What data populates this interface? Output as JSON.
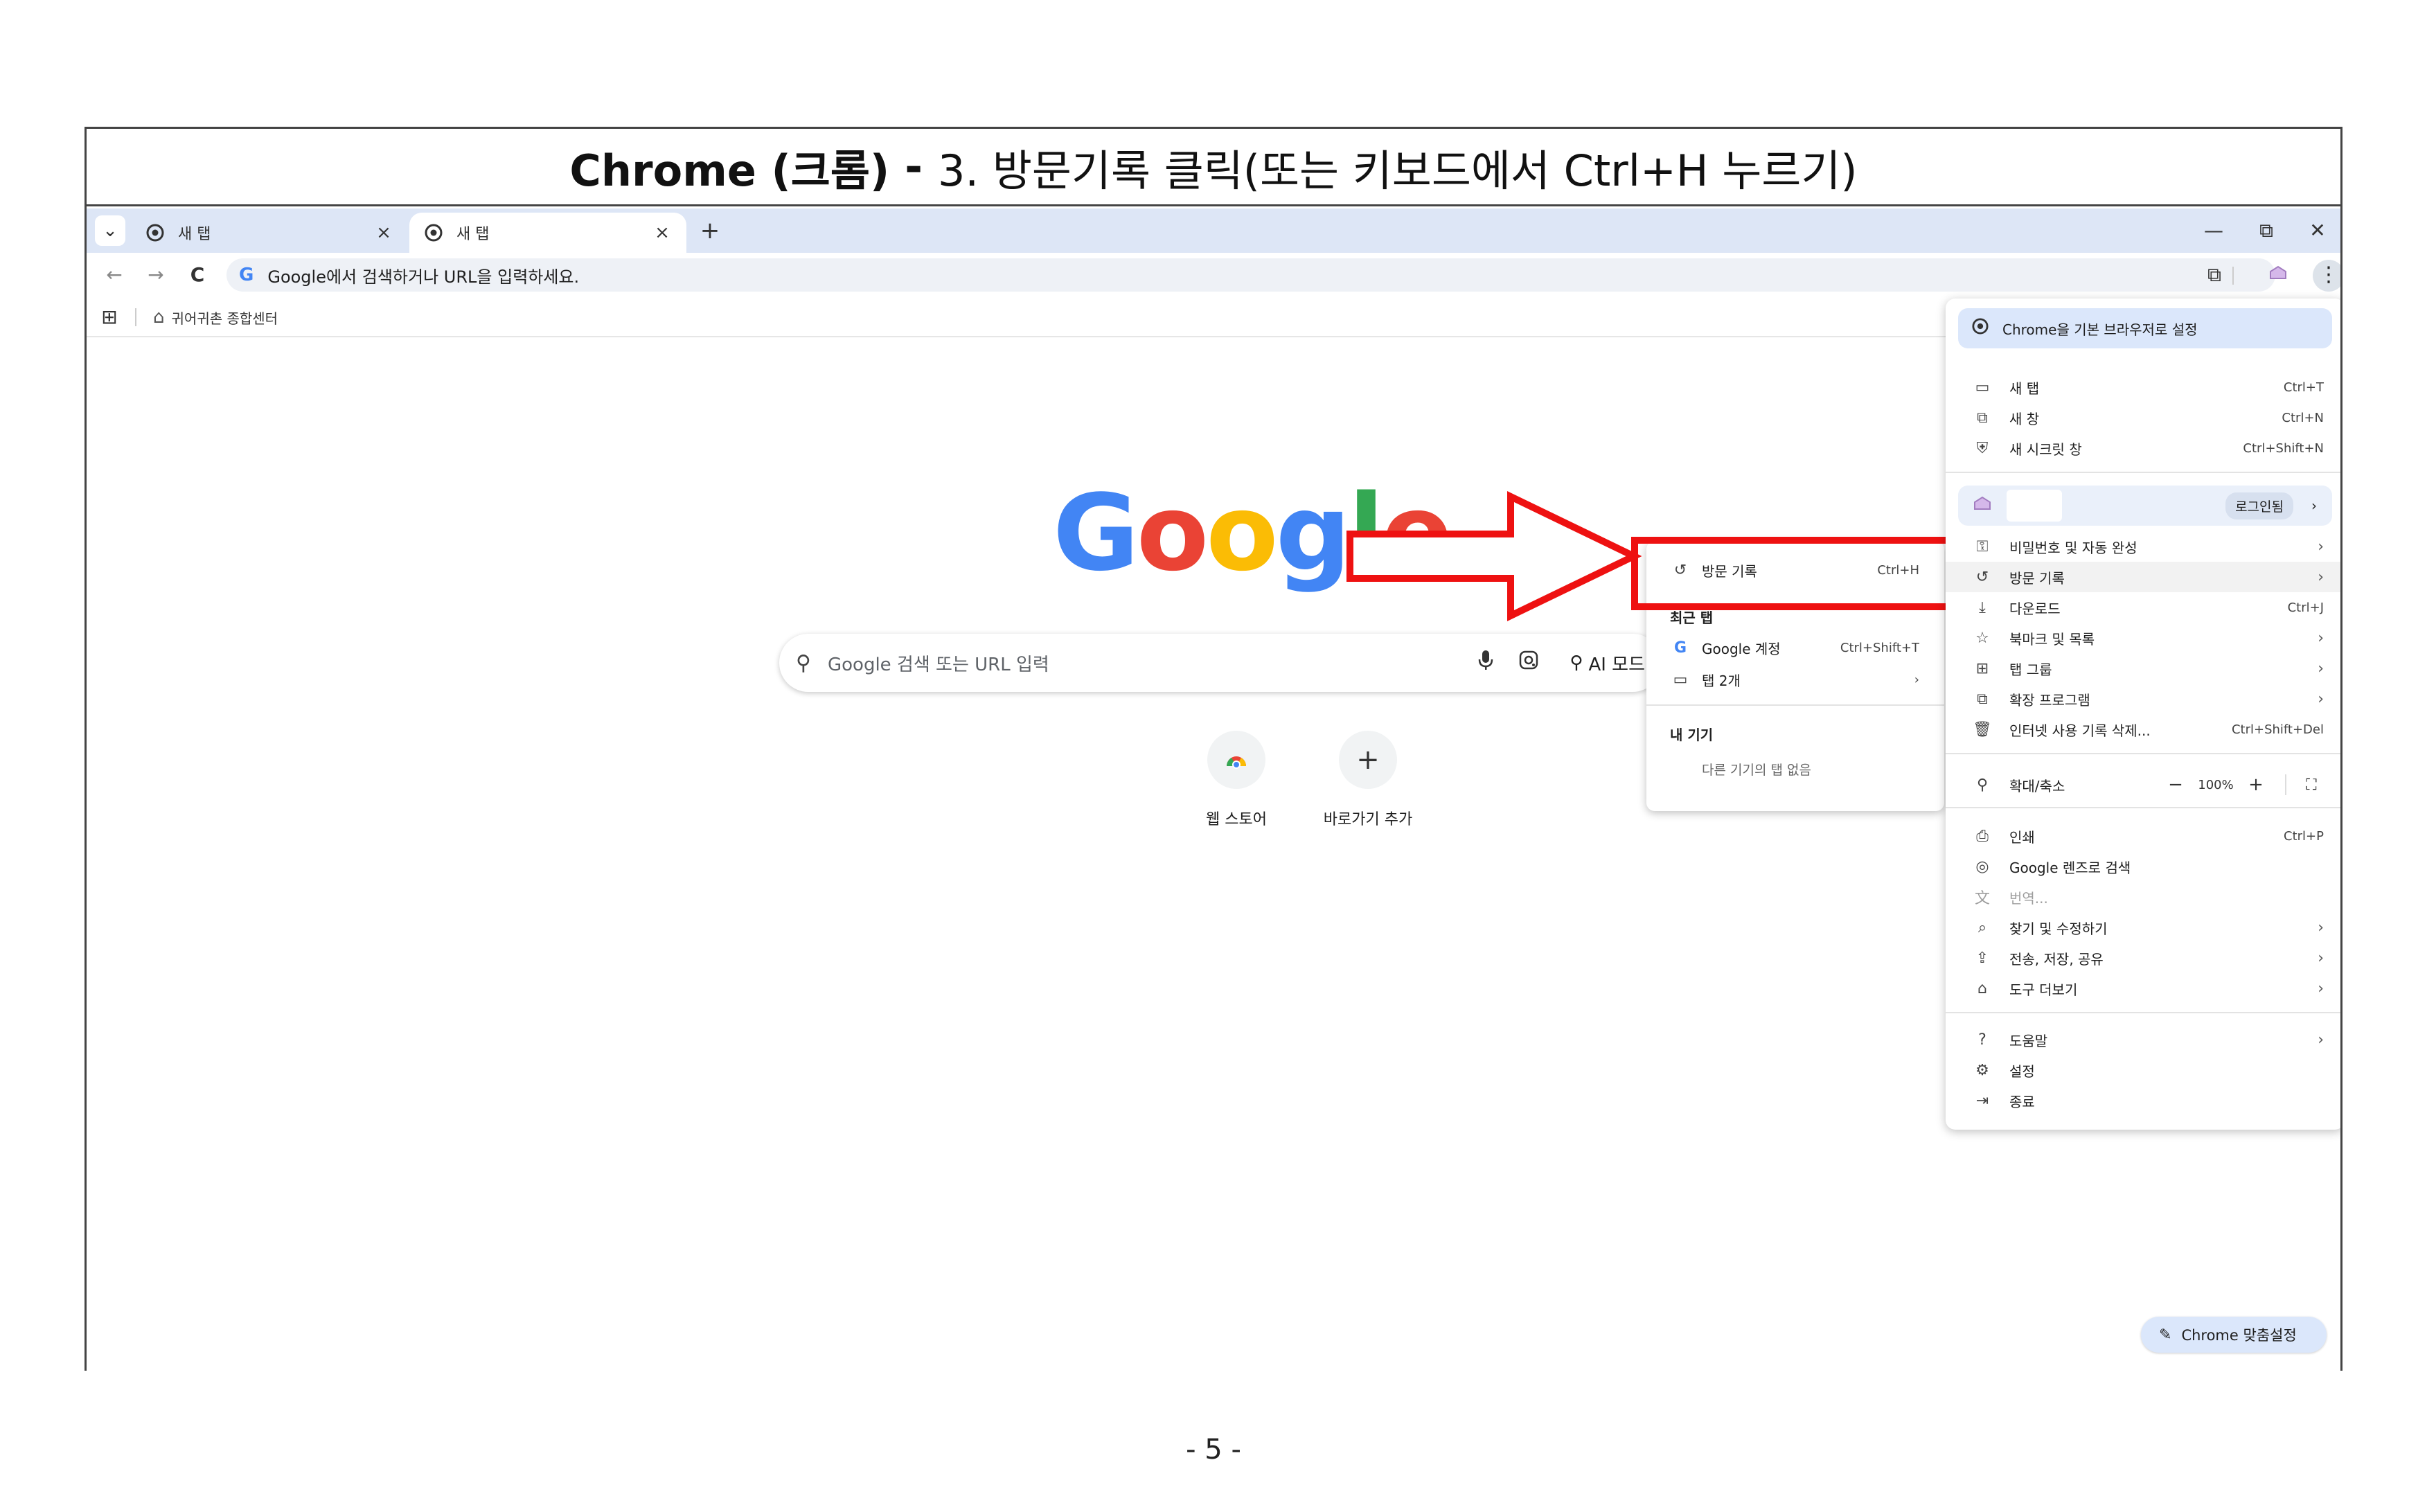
{
  "document": {
    "title_bold": "Chrome (크롬)",
    "title_sep": "-",
    "title_rest": "3. 방문기록 클릭(또는 키보드에서 Ctrl+H 누르기)",
    "page_number": "- 5 -"
  },
  "tabs": [
    {
      "label": "새 탭",
      "close": "×",
      "active": false
    },
    {
      "label": "새 탭",
      "close": "×",
      "active": true
    }
  ],
  "tabstrip": {
    "dropdown": "⌄",
    "new_tab": "+",
    "minimize": "—",
    "restore": "⧉",
    "close": "✕"
  },
  "toolbar": {
    "back": "←",
    "forward": "→",
    "reload": "C",
    "omnibox_g": "G",
    "omnibox_placeholder": "Google에서 검색하거나 URL을 입력하세요.",
    "extensions": "⧉",
    "menu": "⋮"
  },
  "bookmarks": {
    "apps": "⊞",
    "items": [
      {
        "label": "귀어귀촌 종합센터"
      }
    ]
  },
  "content": {
    "logo": [
      "G",
      "o",
      "o",
      "g",
      "l",
      "e"
    ],
    "logo_colors": [
      "#4285f4",
      "#ea4335",
      "#fbbc05",
      "#4285f4",
      "#34a853",
      "#ea4335"
    ],
    "search_placeholder": "Google 검색 또는 URL 입력",
    "ai_mode": "AI 모드",
    "shortcuts": [
      {
        "label": "웹 스토어",
        "icon": "webstore-icon"
      },
      {
        "label": "바로가기 추가",
        "icon": "+"
      }
    ]
  },
  "history_submenu": {
    "history_label": "방문 기록",
    "history_shortcut": "Ctrl+H",
    "recent_tabs_header": "최근 탭",
    "google_account_label": "Google 계정",
    "google_account_shortcut": "Ctrl+Shift+T",
    "tabs_count_label": "탭 2개",
    "my_devices_header": "내 기기",
    "no_tabs_text": "다른 기기의 탭 없음"
  },
  "main_menu": {
    "default_browser": "Chrome을 기본 브라우저로 설정",
    "items_group1": [
      {
        "label": "새 탭",
        "shortcut": "Ctrl+T",
        "icon": "▭"
      },
      {
        "label": "새 창",
        "shortcut": "Ctrl+N",
        "icon": "⧉"
      },
      {
        "label": "새 시크릿 창",
        "shortcut": "Ctrl+Shift+N",
        "icon": "⛨"
      }
    ],
    "login_label": "로그인됨",
    "items_group2": [
      {
        "label": "비밀번호 및 자동 완성",
        "icon": "⚿"
      },
      {
        "label": "방문 기록",
        "icon": "↺"
      },
      {
        "label": "다운로드",
        "shortcut": "Ctrl+J",
        "icon": "⤓"
      },
      {
        "label": "북마크 및 목록",
        "icon": "☆"
      },
      {
        "label": "탭 그룹",
        "icon": "⊞"
      },
      {
        "label": "확장 프로그램",
        "icon": "⧉"
      },
      {
        "label": "인터넷 사용 기록 삭제...",
        "shortcut": "Ctrl+Shift+Del",
        "icon": "🗑"
      }
    ],
    "zoom_label": "확대/축소",
    "zoom_minus": "−",
    "zoom_value": "100%",
    "zoom_plus": "+",
    "zoom_fullscreen": "⛶",
    "items_group3": [
      {
        "label": "인쇄",
        "shortcut": "Ctrl+P",
        "icon": "⎙"
      },
      {
        "label": "Google 렌즈로 검색",
        "icon": "◎"
      },
      {
        "label": "번역...",
        "icon": "文"
      },
      {
        "label": "찾기 및 수정하기",
        "icon": "⌕"
      },
      {
        "label": "전송, 저장, 공유",
        "icon": "⇪"
      },
      {
        "label": "도구 더보기",
        "icon": "⌂"
      }
    ],
    "items_group4": [
      {
        "label": "도움말",
        "icon": "?"
      },
      {
        "label": "설정",
        "icon": "⚙"
      },
      {
        "label": "종료",
        "icon": "⇥"
      }
    ],
    "chevron": "›"
  },
  "customize_button": "Chrome 맞춤설정",
  "colors": {
    "highlight_red": "#ee1111",
    "tabstrip_bg": "#dde6f6",
    "menu_top_bg": "#dbe7fb"
  }
}
